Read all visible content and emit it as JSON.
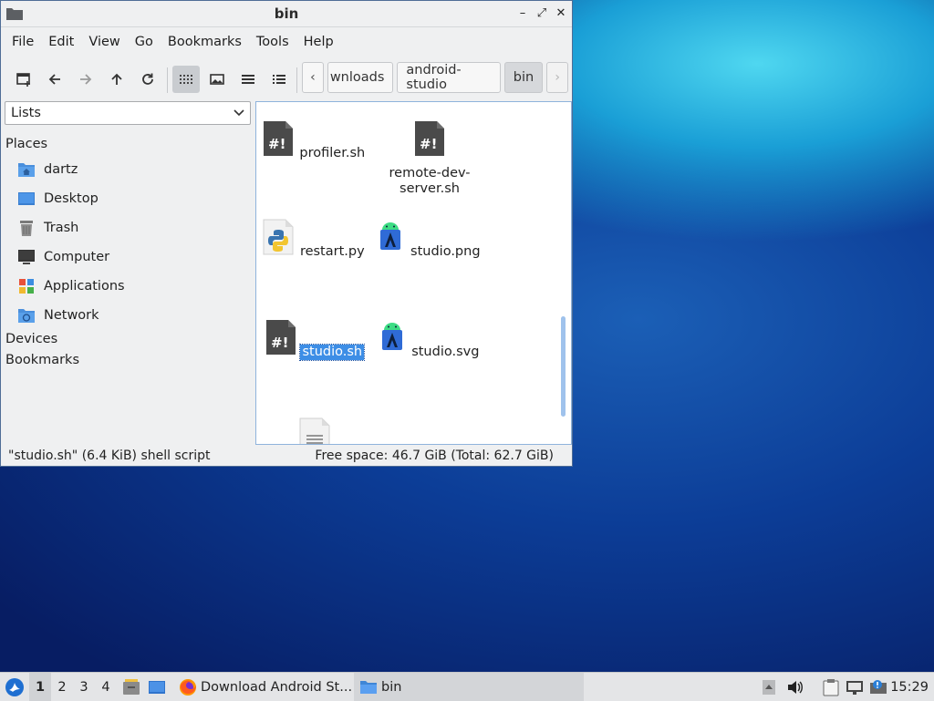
{
  "window": {
    "title": "bin",
    "controls": {
      "minimize": "–",
      "maximize": "⤢",
      "close": "✕"
    }
  },
  "menu": [
    "File",
    "Edit",
    "View",
    "Go",
    "Bookmarks",
    "Tools",
    "Help"
  ],
  "toolbar": {
    "buttons": [
      "new-tab-icon",
      "back-icon",
      "forward-icon",
      "up-icon",
      "reload-icon",
      "icon-view-icon",
      "thumbnail-view-icon",
      "compact-view-icon",
      "detailed-list-view-icon"
    ],
    "active_view": "icon-view"
  },
  "breadcrumb": {
    "items": [
      "wnloads",
      "android-studio",
      "bin"
    ],
    "current": "bin",
    "prev_arrow": "‹",
    "next_arrow": "›"
  },
  "sidebar": {
    "combo_value": "Lists",
    "places_label": "Places",
    "places": [
      {
        "label": "dartz",
        "icon": "home-folder-icon"
      },
      {
        "label": "Desktop",
        "icon": "desktop-icon"
      },
      {
        "label": "Trash",
        "icon": "trash-icon"
      },
      {
        "label": "Computer",
        "icon": "computer-icon"
      },
      {
        "label": "Applications",
        "icon": "applications-icon"
      },
      {
        "label": "Network",
        "icon": "network-icon"
      }
    ],
    "devices_label": "Devices",
    "bookmarks_label": "Bookmarks"
  },
  "files": [
    {
      "name": "profiler.sh",
      "icon": "shell-script-icon"
    },
    {
      "name": "remote-dev-server.sh",
      "name_line1": "remote-dev-",
      "name_line2": "server.sh",
      "icon": "shell-script-icon"
    },
    {
      "name": "restart.py",
      "icon": "python-file-icon"
    },
    {
      "name": "studio.png",
      "icon": "android-studio-icon"
    },
    {
      "name": "studio.sh",
      "icon": "shell-script-icon",
      "selected": true
    },
    {
      "name": "studio.svg",
      "icon": "android-studio-icon"
    },
    {
      "name": "",
      "icon": "text-file-icon"
    }
  ],
  "status": {
    "left": "\"studio.sh\" (6.4 KiB) shell script",
    "right": "Free space: 46.7 GiB (Total: 62.7 GiB)"
  },
  "taskbar": {
    "workspaces": [
      "1",
      "2",
      "3",
      "4"
    ],
    "current_workspace": "1",
    "tasks": [
      {
        "label": "Download Android St...",
        "icon": "firefox-icon"
      },
      {
        "label": "bin",
        "icon": "folder-icon",
        "active": true
      }
    ],
    "clock": "15:29"
  },
  "colors": {
    "selection": "#3d8ee6",
    "file_icon_dark": "#4a4a4a",
    "folder_blue": "#4a8fdc"
  }
}
